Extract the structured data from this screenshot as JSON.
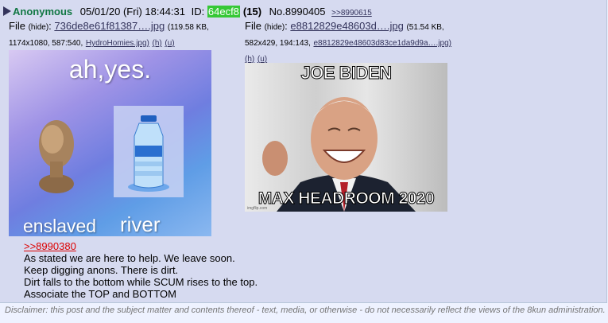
{
  "post": {
    "name": "Anonymous",
    "date": "05/01/20 (Fri) 18:44:31",
    "id_label": "ID:",
    "id_value": "64ecf8",
    "post_count": "(15)",
    "number": "No.8990405",
    "backlink": ">>8990615"
  },
  "files": [
    {
      "label": "File",
      "hide": "(hide)",
      "name": "736de8e61f81387….jpg",
      "meta_line1": "(119.58 KB,",
      "meta_line2": "1174x1080, 587:540,",
      "original": "HydroHomies.jpg)",
      "link_h": "(h)",
      "link_u": "(u)",
      "image": {
        "top_text": "ah,yes.",
        "bottom_left_text": "enslaved",
        "bottom_right_text": "river"
      }
    },
    {
      "label": "File",
      "hide": "(hide)",
      "name": "e8812829e48603d….jpg",
      "meta_line1": "(51.54 KB,",
      "meta_line2": "582x429, 194:143,",
      "original": "e8812829e48603d83ce1da9d9a….jpg)",
      "link_h": "(h)",
      "link_u": "(u)",
      "image": {
        "top_text": "JOE BIDEN",
        "bottom_text": "MAX HEADROOM 2020",
        "watermark": "imgflip.com"
      }
    }
  ],
  "body": {
    "quote": ">>8990380",
    "lines": [
      "As stated we are here to help. We leave soon.",
      "Keep digging anons. There is dirt.",
      "Dirt falls to the bottom while SCUM rises to the top.",
      "Associate the TOP and BOTTOM"
    ]
  },
  "disclaimer": "Disclaimer: this post and the subject matter and contents thereof - text, media, or otherwise - do not necessarily reflect the views of the 8kun administration."
}
